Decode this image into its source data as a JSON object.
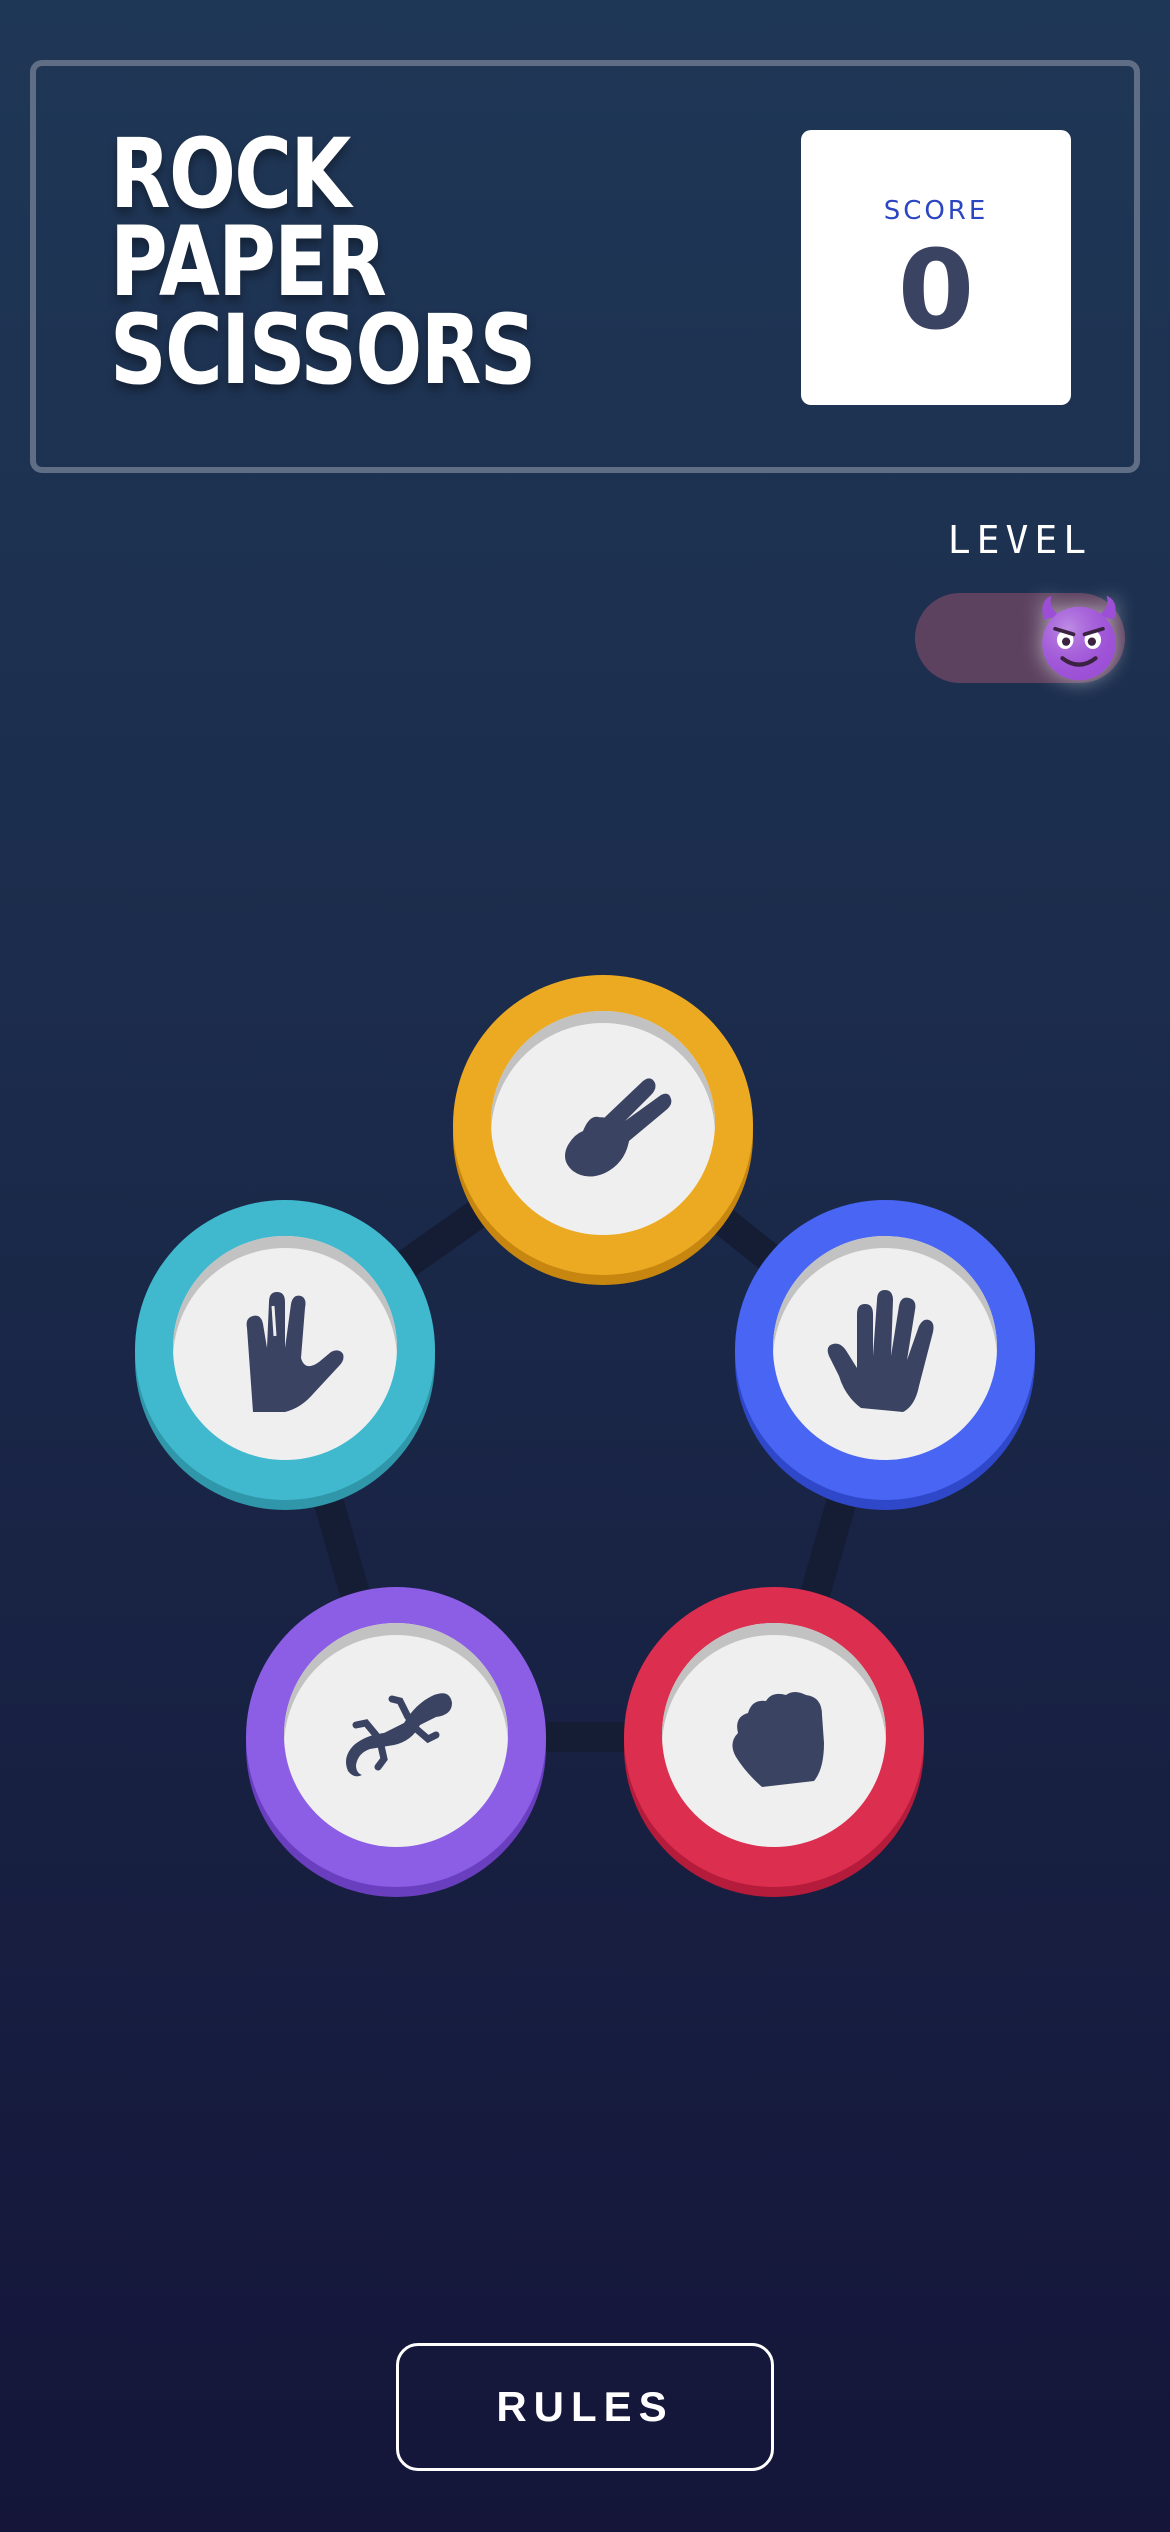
{
  "header": {
    "title_lines": [
      "ROCK",
      "PAPER",
      "SCISSORS"
    ],
    "score_label": "SCORE",
    "score_value": "0"
  },
  "level": {
    "label": "LEVEL",
    "mode_icon": "smiling-devil-face-icon",
    "mode_emoji": "😈"
  },
  "choices": [
    {
      "id": "scissors",
      "icon": "scissors-hand-icon",
      "color": "#eca922"
    },
    {
      "id": "paper",
      "icon": "paper-hand-icon",
      "color": "#4865f4"
    },
    {
      "id": "rock",
      "icon": "rock-fist-icon",
      "color": "#dc2e4e"
    },
    {
      "id": "lizard",
      "icon": "lizard-icon",
      "color": "#8c5de5"
    },
    {
      "id": "spock",
      "icon": "spock-hand-icon",
      "color": "#40b9ce"
    }
  ],
  "footer": {
    "rules_label": "RULES"
  },
  "colors": {
    "background_top": "#1f3756",
    "background_bottom": "#141539",
    "header_border": "#606e85",
    "score_label": "#2a46c0",
    "score_value": "#3b4363",
    "icon_fill": "#3b4363"
  }
}
